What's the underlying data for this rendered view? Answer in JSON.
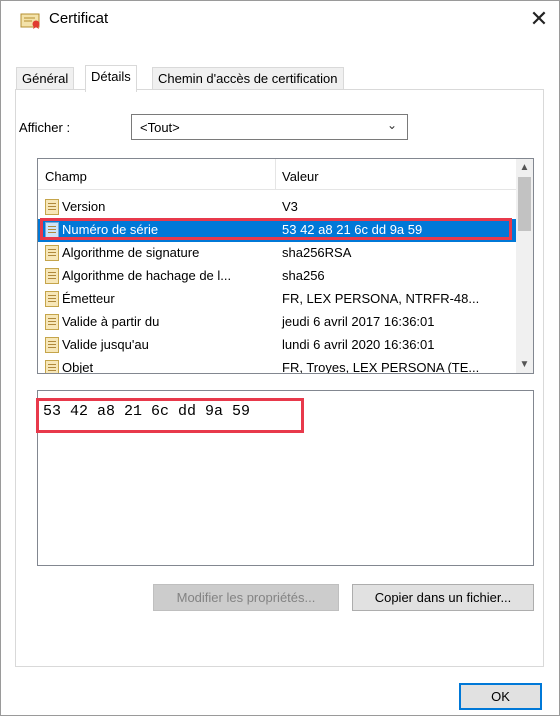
{
  "window": {
    "title": "Certificat",
    "close_symbol": "✕"
  },
  "tabs": [
    {
      "label": "Général"
    },
    {
      "label": "Détails"
    },
    {
      "label": "Chemin d'accès de certification"
    }
  ],
  "show": {
    "label": "Afficher :",
    "value": "<Tout>"
  },
  "list": {
    "columns": {
      "field": "Champ",
      "value": "Valeur"
    },
    "rows": [
      {
        "field": "Version",
        "value": "V3"
      },
      {
        "field": "Numéro de série",
        "value": "53 42 a8 21 6c dd 9a 59"
      },
      {
        "field": "Algorithme de signature",
        "value": "sha256RSA"
      },
      {
        "field": "Algorithme de hachage de l...",
        "value": "sha256"
      },
      {
        "field": "Émetteur",
        "value": "FR, LEX PERSONA, NTRFR-48..."
      },
      {
        "field": "Valide à partir du",
        "value": "jeudi 6 avril 2017 16:36:01"
      },
      {
        "field": "Valide jusqu'au",
        "value": "lundi 6 avril 2020 16:36:01"
      },
      {
        "field": "Objet",
        "value": "FR, Troyes, LEX PERSONA (TE..."
      }
    ],
    "selected_index": 1
  },
  "detail": {
    "text": "53 42 a8 21 6c dd 9a 59"
  },
  "buttons": {
    "edit_properties": "Modifier les propriétés...",
    "copy_to_file": "Copier dans un fichier...",
    "ok": "OK"
  },
  "colors": {
    "selection": "#0078d7",
    "annotation": "#e8394b"
  }
}
